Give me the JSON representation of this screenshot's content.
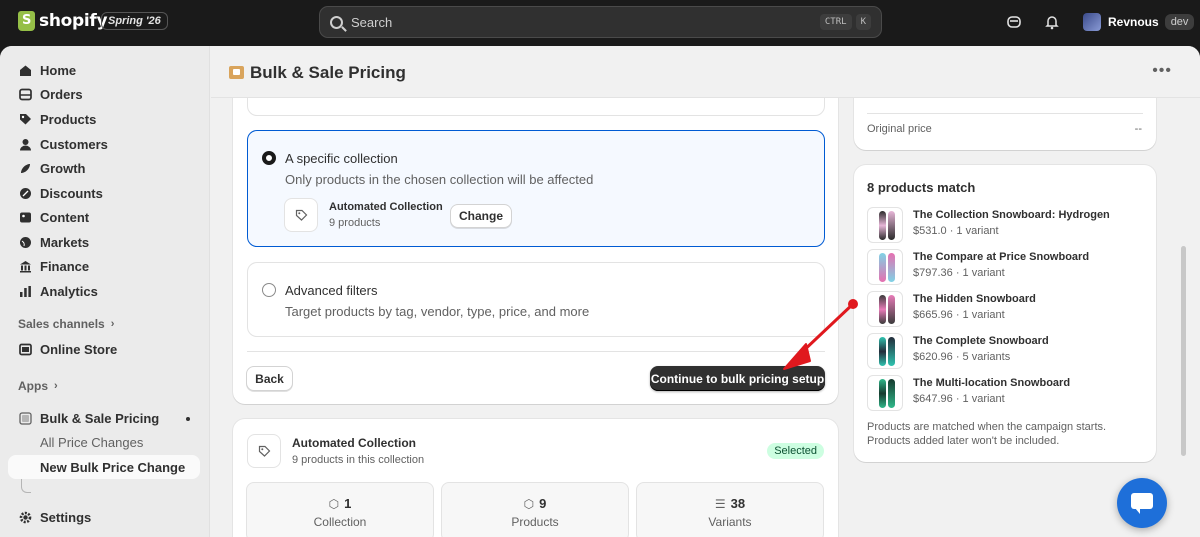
{
  "topbar": {
    "brand": "shopify",
    "edition": "Spring '26",
    "search_placeholder": "Search",
    "shortcut_ctrl": "CTRL",
    "shortcut_key": "K",
    "user_name": "Revnous",
    "user_badge": "dev"
  },
  "sidebar": {
    "items": [
      {
        "label": "Home",
        "icon": "home-icon"
      },
      {
        "label": "Orders",
        "icon": "orders-icon"
      },
      {
        "label": "Products",
        "icon": "tag-icon"
      },
      {
        "label": "Customers",
        "icon": "person-icon"
      },
      {
        "label": "Growth",
        "icon": "growth-icon"
      },
      {
        "label": "Discounts",
        "icon": "discount-icon"
      },
      {
        "label": "Content",
        "icon": "content-icon"
      },
      {
        "label": "Markets",
        "icon": "globe-icon"
      },
      {
        "label": "Finance",
        "icon": "bank-icon"
      },
      {
        "label": "Analytics",
        "icon": "chart-icon"
      }
    ],
    "sales_channels_label": "Sales channels",
    "online_store_label": "Online Store",
    "apps_label": "Apps",
    "app_name": "Bulk & Sale Pricing",
    "sub_items": [
      "All Price Changes",
      "New Bulk Price Change"
    ],
    "settings_label": "Settings"
  },
  "page": {
    "title": "Bulk & Sale Pricing"
  },
  "scope": {
    "collection_option": {
      "title": "A specific collection",
      "description": "Only products in the chosen collection will be affected",
      "collection_name": "Automated Collection",
      "collection_count": "9 products",
      "change_label": "Change"
    },
    "advanced_option": {
      "title": "Advanced filters",
      "description": "Target products by tag, vendor, type, price, and more"
    },
    "back_label": "Back",
    "continue_label": "Continue to bulk pricing setup"
  },
  "collection_card": {
    "name": "Automated Collection",
    "subtitle": "9 products in this collection",
    "badge": "Selected",
    "stats": [
      {
        "value": "1",
        "label": "Collection",
        "icon": "collection-icon"
      },
      {
        "value": "9",
        "label": "Products",
        "icon": "tag-icon"
      },
      {
        "value": "38",
        "label": "Variants",
        "icon": "list-icon"
      }
    ]
  },
  "summary": {
    "original_price_label": "Original price",
    "original_price_value": "--"
  },
  "matches": {
    "title": "8 products match",
    "products": [
      {
        "name": "The Collection Snowboard: Hydrogen",
        "meta": "$531.0 · 1 variant",
        "colors": [
          "#2b2b2b",
          "#e7b6d8"
        ]
      },
      {
        "name": "The Compare at Price Snowboard",
        "meta": "$797.36 · 1 variant",
        "colors": [
          "#7fd3e6",
          "#e66fb0"
        ]
      },
      {
        "name": "The Hidden Snowboard",
        "meta": "$665.96 · 1 variant",
        "colors": [
          "#3b3b3b",
          "#e87bb8"
        ]
      },
      {
        "name": "The Complete Snowboard",
        "meta": "$620.96 · 5 variants",
        "colors": [
          "#2fc4b0",
          "#222b3a"
        ]
      },
      {
        "name": "The Multi-location Snowboard",
        "meta": "$647.96 · 1 variant",
        "colors": [
          "#2fb88a",
          "#163a2e"
        ]
      }
    ],
    "footnote_1": "Products are matched when the campaign starts.",
    "footnote_2": "Products added later won't be included."
  },
  "colors": {
    "accent": "#005bd3",
    "annotation_arrow": "#e0181e",
    "primary_button": "#303030"
  }
}
